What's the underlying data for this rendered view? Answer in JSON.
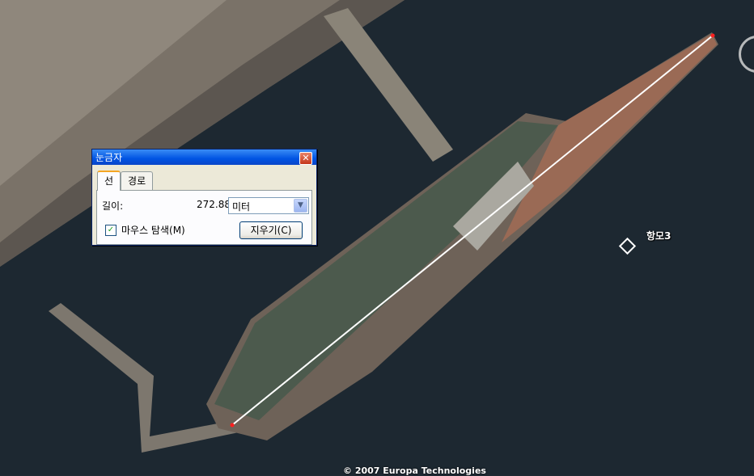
{
  "dialog": {
    "title": "눈금자",
    "close_symbol": "✕",
    "tabs": [
      {
        "label": "선",
        "active": true
      },
      {
        "label": "경로",
        "active": false
      }
    ],
    "length_label": "길이:",
    "length_value": "272.88",
    "unit_selected": "미터",
    "mouse_nav_label": "마우스 탐색(M)",
    "mouse_nav_checked": true,
    "clear_button": "지우기(C)"
  },
  "placemark": {
    "label": "항모3",
    "icon": "diamond-placemark-icon"
  },
  "copyright": "© 2007 Europa Technologies",
  "colors": {
    "water": "#1f2a33",
    "deck": "#4a5a4a",
    "measure_line": "#ffffff",
    "endpoint": "#ff2020"
  }
}
